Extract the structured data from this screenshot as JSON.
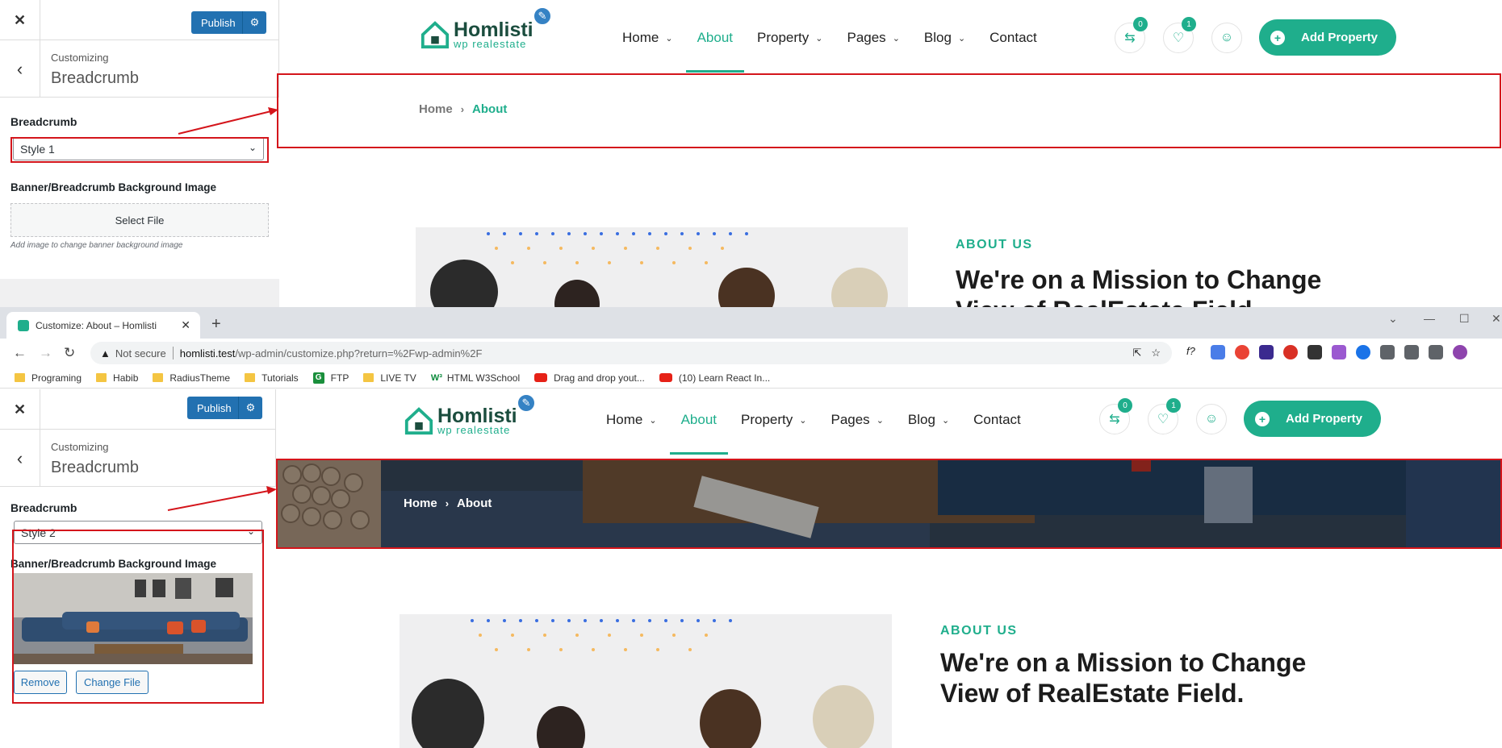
{
  "customizer": {
    "close_icon": "close-icon",
    "publish_label": "Publish",
    "subheading": "Customizing",
    "section_title": "Breadcrumb",
    "breadcrumb_label": "Breadcrumb",
    "bg_label": "Banner/Breadcrumb Background Image",
    "select_file_label": "Select File",
    "help_text": "Add image to change banner background image",
    "remove_label": "Remove",
    "change_file_label": "Change File"
  },
  "style1": {
    "selected": "Style 1"
  },
  "style2": {
    "selected": "Style 2"
  },
  "site": {
    "logo_name": "Homlisti",
    "logo_tag": "wp realestate",
    "nav": [
      {
        "label": "Home",
        "dropdown": true
      },
      {
        "label": "About",
        "dropdown": false,
        "active": true
      },
      {
        "label": "Property",
        "dropdown": true
      },
      {
        "label": "Pages",
        "dropdown": true
      },
      {
        "label": "Blog",
        "dropdown": true
      },
      {
        "label": "Contact",
        "dropdown": false
      }
    ],
    "compare_count": "0",
    "wishlist_count": "1",
    "add_property_label": "Add Property",
    "breadcrumb_home": "Home",
    "breadcrumb_current": "About",
    "about_kicker": "ABOUT US",
    "about_heading_line1": "We're on a Mission to Change",
    "about_heading_line2": "View of RealEstate Field."
  },
  "browser": {
    "tab_title": "Customize: About – Homlisti",
    "not_secure": "Not secure",
    "url_host": "homlisti.test",
    "url_path": "/wp-admin/customize.php?return=%2Fwp-admin%2F",
    "bookmarks": [
      {
        "label": "Programing",
        "icon": "folder"
      },
      {
        "label": "Habib",
        "icon": "folder"
      },
      {
        "label": "RadiusTheme",
        "icon": "folder"
      },
      {
        "label": "Tutorials",
        "icon": "folder"
      },
      {
        "label": "FTP",
        "icon": "g-badge"
      },
      {
        "label": "LIVE TV",
        "icon": "folder"
      },
      {
        "label": "HTML W3School",
        "icon": "w3"
      },
      {
        "label": "Drag and drop yout...",
        "icon": "youtube"
      },
      {
        "label": "(10) Learn React In...",
        "icon": "youtube"
      }
    ]
  },
  "colors": {
    "accent": "#1fae8c",
    "wp_blue": "#2271b1",
    "annotation_red": "#d4151b"
  }
}
